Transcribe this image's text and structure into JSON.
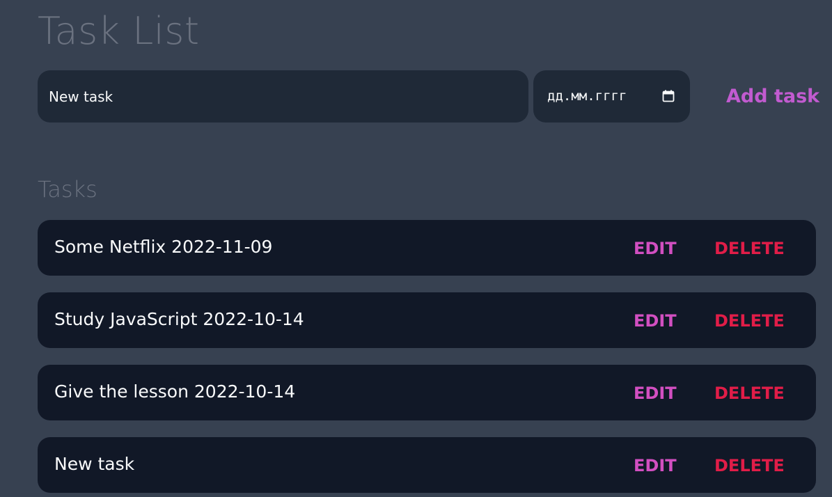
{
  "header": {
    "title": "Task List"
  },
  "form": {
    "task_input_value": "New task",
    "date_placeholder": "дд.мм.гггг",
    "calendar_icon": "calendar-icon",
    "add_button_label": "Add task"
  },
  "tasks_section": {
    "heading": "Tasks",
    "edit_label": "EDIT",
    "delete_label": "DELETE",
    "items": [
      {
        "text": "Some Netflix 2022-11-09"
      },
      {
        "text": "Study JavaScript 2022-10-14"
      },
      {
        "text": "Give the lesson 2022-10-14"
      },
      {
        "text": "New task"
      }
    ]
  },
  "colors": {
    "background": "#374151",
    "input_background": "#1f2937",
    "row_background": "#111827",
    "title_text": "#6b7280",
    "accent_pink": "#ec4899",
    "accent_purple": "#a855f7",
    "delete_red": "#e11d48"
  }
}
